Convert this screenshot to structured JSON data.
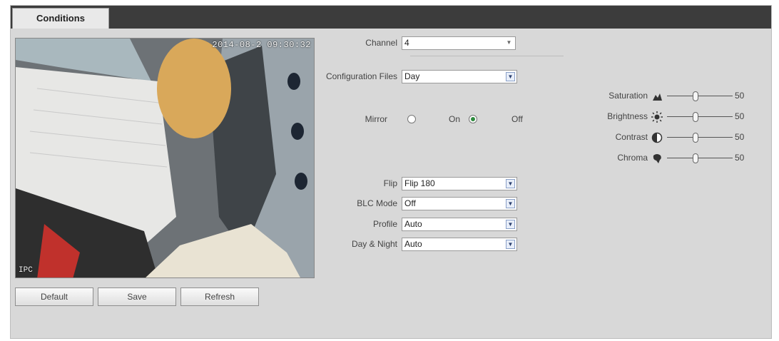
{
  "tab": {
    "label": "Conditions"
  },
  "preview": {
    "timestamp": "2014-08-2 09:30:32",
    "channel_name": "IPC"
  },
  "buttons": {
    "default": "Default",
    "save": "Save",
    "refresh": "Refresh"
  },
  "channel": {
    "label": "Channel",
    "value": "4"
  },
  "config_files": {
    "label": "Configuration Files",
    "value": "Day"
  },
  "mirror": {
    "label": "Mirror",
    "on": "On",
    "off": "Off",
    "selected": "Off"
  },
  "flip": {
    "label": "Flip",
    "value": "Flip 180"
  },
  "blc_mode": {
    "label": "BLC Mode",
    "value": "Off"
  },
  "profile": {
    "label": "Profile",
    "value": "Auto"
  },
  "day_night": {
    "label": "Day & Night",
    "value": "Auto"
  },
  "sliders": [
    {
      "label": "Saturation",
      "value": "50",
      "icon": "saturation-icon"
    },
    {
      "label": "Brightness",
      "value": "50",
      "icon": "brightness-icon"
    },
    {
      "label": "Contrast",
      "value": "50",
      "icon": "contrast-icon"
    },
    {
      "label": "Chroma",
      "value": "50",
      "icon": "chroma-icon"
    }
  ],
  "colors": {
    "topbar": "#3c3c3c",
    "panel": "#d8d8d8",
    "radio_checked": "#2d8a3e"
  }
}
